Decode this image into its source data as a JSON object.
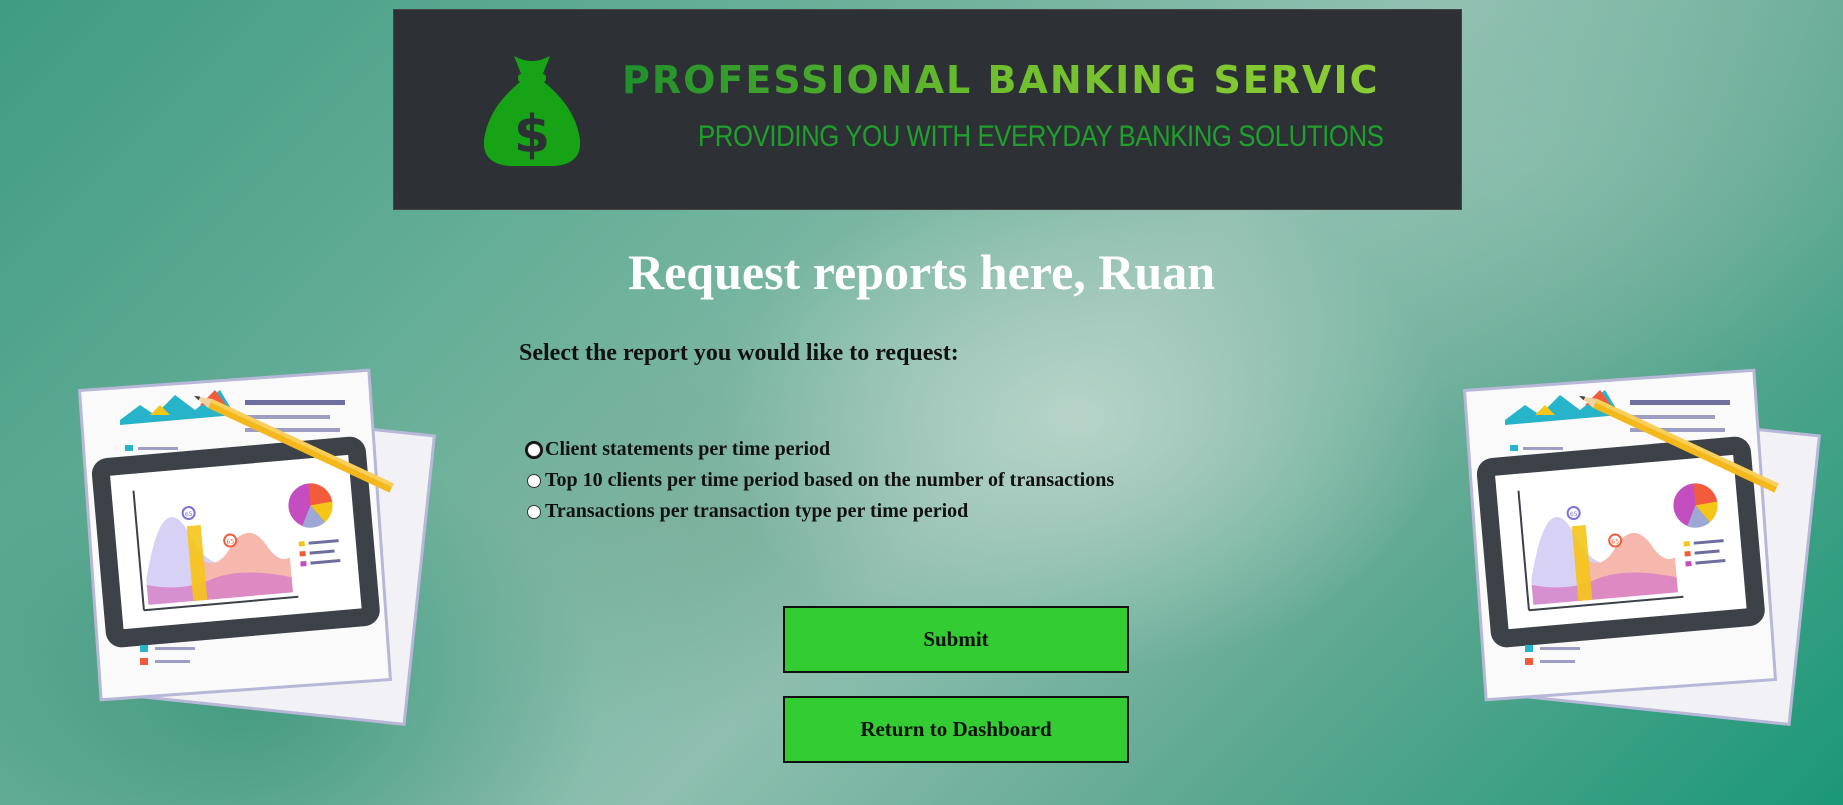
{
  "banner": {
    "brand": "PROFESSIONAL BANKING SERVICES",
    "tagline": "PROVIDING YOU WITH EVERYDAY BANKING SOLUTIONS",
    "logo_icon": "money-bag-icon",
    "accent": "#33cc33"
  },
  "page": {
    "title": "Request reports here, Ruan",
    "prompt": "Select the report you would like to request:"
  },
  "report_options": [
    {
      "label": "Client statements per time period",
      "selected": false,
      "focused": true
    },
    {
      "label": "Top 10 clients per time period based on the number of transactions",
      "selected": false
    },
    {
      "label": "Transactions per transaction type per time period",
      "selected": false
    }
  ],
  "actions": {
    "submit_label": "Submit",
    "return_label": "Return to Dashboard"
  },
  "illustration": {
    "chart_labels": [
      "65",
      "65"
    ]
  }
}
